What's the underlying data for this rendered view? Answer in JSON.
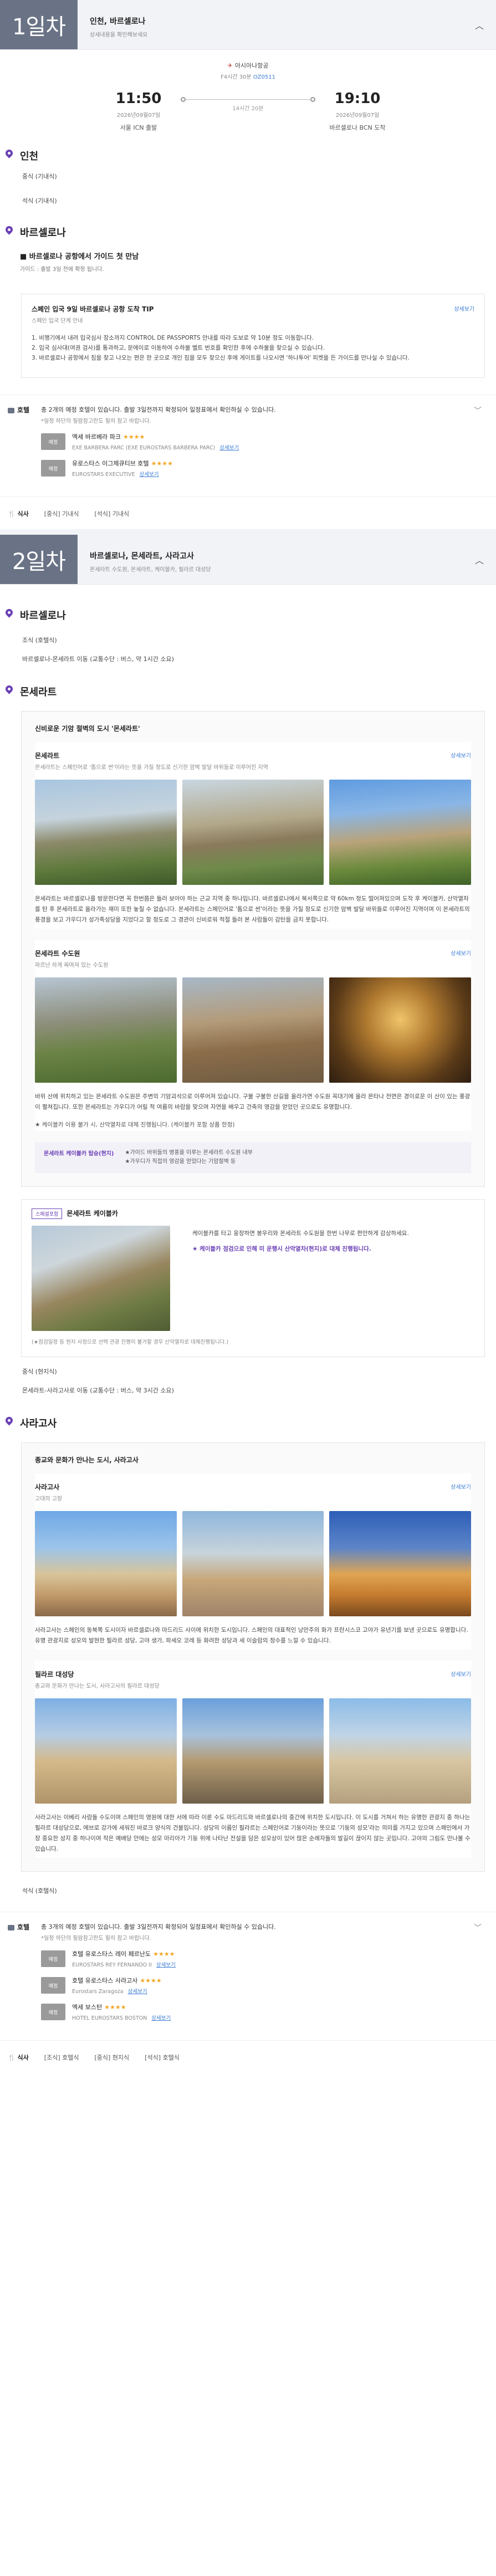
{
  "day1": {
    "badge": "1일차",
    "title": "인천, 바르셀로나",
    "subtitle": "상세내용을 확인해보세요",
    "flight": {
      "airline": "아시아나항공",
      "flight_no_label": "F4시간 30분",
      "flight_no": "OZ0511",
      "dep_time": "11:50",
      "dep_date": "2026년09월07일",
      "dep_place": "서울 ICN 출발",
      "arr_time": "19:10",
      "arr_date": "2026년09월07일",
      "arr_place": "바르셀로나 BCN 도착",
      "duration": "14시간 20분"
    },
    "city1": "인천",
    "meal1": "중식 (기내식)",
    "meal2": "석식 (기내식)",
    "city2": "바르셀로나",
    "item_title": "■ 바르셀로나 공항에서 가이드 첫 만남",
    "item_sub": "가이드 : 출발 3일 전에 확정 됩니다.",
    "tip_title": "스페인 입국 9일 바르셀로나 공항 도착 TIP",
    "tip_sub": "스페인 입국 단계 안내",
    "tip_more": "상세보기",
    "tip_lines": [
      "1. 비행기에서 내려 입국심사 장소까지 CONTROL DE PASSPORTS 안내를 따라 도보로 약 10분 정도 이동합니다.",
      "2. 입국 심사대(여권 검사)를 통과하고, 문에이로 이동하여 수하물 벨트 번호를 확인한 후에 수하물을 찾으실 수 있습니다.",
      "3. 바르셀로나 공항에서 짐을 찾고 나오는 편은 한 곳으로 개인 짐을 모두 찾으신 후에 게이트를 나오시면 '하나투어' 피켓을 든 가이드를 만나실 수 있습니다."
    ],
    "hotel": {
      "label": "호텔",
      "notice": "총 2개의 예정 호텔이 있습니다. 출발 3일전까지 확정되어 일정표에서 확인하실 수 있습니다.",
      "notice_bold": "2개의 예정 호텔",
      "notice2": "*일정 하단의 필람참고란도 필히 참고 바랍니다.",
      "items": [
        {
          "thumb": "예정",
          "name": "엑세 바르베라 파크",
          "stars": "★★★★",
          "sub": "EXE BARBERA PARC (EXE EUROSTARS BARBERA PARC)",
          "link": "상세보기"
        },
        {
          "thumb": "예정",
          "name": "유로스타스 이그제큐티브 호텔",
          "stars": "★★★★",
          "sub": "EUROSTARS EXECUTIVE",
          "link": "상세보기"
        }
      ]
    },
    "meals_label": "식사",
    "meals": [
      "[중식] 기내식",
      "[석식] 기내식"
    ]
  },
  "day2": {
    "badge": "2일차",
    "title": "바르셀로나, 몬세라트, 사라고사",
    "subtitle": "몬세라트 수도원, 몬세라트, 케이블카, 필라르 대성당",
    "city1": "바르셀로나",
    "meal1": "조식 (호텔식)",
    "move1": "바르셀로나-몬세라트 이동 (교통수단 : 버스, 약 1시간 소요)",
    "city2": "몬세라트",
    "lead1": "신비로운 기암 절벽의 도시 '몬세라트'",
    "attr1": {
      "title": "몬세라트",
      "sub": "몬세라트는 스페인어로 '톱으로 썬'이라는 뜻을 가질 정도로 신기한 암벽 발달 바위들로 이루어진 지역",
      "more": "상세보기",
      "desc": "몬세라트는 바르셀로나를 방문한다면 꼭 한번쯤은 들러 보아야 하는 근교 지역 중 하나입니다. 바르셀로나에서 북서쪽으로 약 60km 정도 떨어져있으며 도착 후 케이블카, 산악열차를 탄 후 몬세라트로 올라가는 재미 또한 놓칠 수 없습니다. 몬세라트는 스페인어로 '톱으로 썬'이라는 뜻을 가질 정도로 신기한 암벽 발달 바위들로 이루어진 지역이며 이 몬세라트의 풍경을 보고 가우디가 성가족성당을 지었다고 할 정도로 그 경관이 신비로워 적절 들러 본 사람들이 감탄을 금치 못합니다."
    },
    "attr2": {
      "title": "몬세라트 수도원",
      "sub": "파르난 하게 짜여져 있는 수도원",
      "more": "상세보기",
      "desc": "바위 산에 위치하고 있는 몬세라트 수도원은 주변의 기암괴석으로 이루어져 있습니다. 구불 구불한 산길을 올라가면 수도원 꼭대기에 올라 몬타나 전면은 경이로운 이 산이 있는 풍광이 펼쳐집니다. 또한 몬세라트는 가우디가 어릴 적 여름의 바람을 맞으며 자연을 배우고 건축의 영감을 얻었던 곳으로도 유명합니다.",
      "note": "★ 케이블카 이용 불가 시, 산악열차로 대체 진행됩니다. (케이블카 포함 상품 한정)"
    },
    "opt_band": {
      "tag": "몬세라트 케이블카 탑승(현지)",
      "lines": [
        "★가이드 바위들의 병풍을 이루는 몬세라트 수도원 내부",
        "★가우디가 직접의 영감을 얻었다는 기암절벽 등"
      ]
    },
    "option": {
      "tag": "스페셜포함",
      "title": "몬세라트 케이블카",
      "text": "케이블카를 타고 웅장하면 봉우리와 몬세라트 수도원을 한번 나무로 편안하게 감상하세요.",
      "purple": "★ 케이블카 점검으로 인해 미 운행시 산악열차(현지)로 대체 진행됩니다.",
      "foot": "(★점검일정 등 현지 사정으로 선택 관광 진행이 불가할 경우 산악열차로 대체진행됩니다.)"
    },
    "meal2": "중식 (현지식)",
    "move2": "몬세라트-사라고사로 이동 (교통수단 : 버스, 약 3시간 소요)",
    "city3": "사라고사",
    "lead2": "종교와 문화가 만나는 도시, 사라고사",
    "attr3": {
      "title": "사라고사",
      "sub": "고대의 고장",
      "more": "상세보기",
      "desc": "사라고사는 스페인의 동북쪽 도시이자 바르셀로나와 마드리드 사이에 위치한 도시입니다. 스페인의 대표적인 낭만주의 화가 프란시스코 고야가 유년기를 보낸 곳으로도 유명합니다. 유명 관광지로 성모의 발현한 필라르 성당, 고야 생가, 파세오 코레 등 화려한 성당과 세 이슬람의 정수를 느낄 수 있습니다."
    },
    "attr4": {
      "title": "필라르 대성당",
      "sub": "종교와 문화가 만나는 도시, 사라고사의 필라르 대성당",
      "more": "상세보기",
      "desc": "사라고사는 이베리 사람들 수도이며 스페인의 영원에 대한 서에 따라 이룬 수도 마드리드와 바르셀로나의 중간에 위치한 도시입니다. 이 도시를 거쳐서 하는 유명한 관광지 중 하나는 필라르 대성당으로, 에브로 강가에 세워진 바로크 양식의 건물입니다. 성당의 이름인 필라르는 스페인어로 기둥이라는 뜻으로 '기둥의 성모'라는 의미를 가지고 있으며 스페인에서 가장 중요한 성지 중 하나이며 작은 예배당 안에는 성모 마리아가 기둥 위에 나타난 전설을 담은 성모상이 있어 많은 순례자들의 발길이 끊이지 않는 곳입니다. 고야의 그림도 만나볼 수 있습니다."
    },
    "meal3": "석식 (호텔식)",
    "hotel": {
      "label": "호텔",
      "notice": "총 3개의 예정 호텔이 있습니다. 출발 3일전까지 확정되어 일정표에서 확인하실 수 있습니다.",
      "notice_bold": "3개의 예정 호텔",
      "notice2": "*일정 하단의 필람참고란도 필히 참고 바랍니다.",
      "items": [
        {
          "thumb": "예정",
          "name": "호텔 유로스타스 레이 페르난도",
          "stars": "★★★★",
          "sub": "EUROSTARS REY FERNANDO II",
          "link": "상세보기"
        },
        {
          "thumb": "예정",
          "name": "호텔 유로스타스 사라고사",
          "stars": "★★★★",
          "sub": "Eurostars Zaragoza",
          "link": "상세보기"
        },
        {
          "thumb": "예정",
          "name": "엑세 보스턴",
          "stars": "★★★★",
          "sub": "HOTEL EUROSTARS BOSTON",
          "link": "상세보기"
        }
      ]
    },
    "meals_label": "식사",
    "meals": [
      "[조식] 호텔식",
      "[중식] 현지식",
      "[석식] 호텔식"
    ]
  },
  "colors": {
    "accent": "#6a3fb5",
    "badge": "#6a7385",
    "link": "#3a7bd5",
    "star": "#f5a623"
  },
  "icons": {
    "pin": "map-pin-icon",
    "toggle": "chevron-up-icon",
    "plane": "airplane-icon"
  }
}
